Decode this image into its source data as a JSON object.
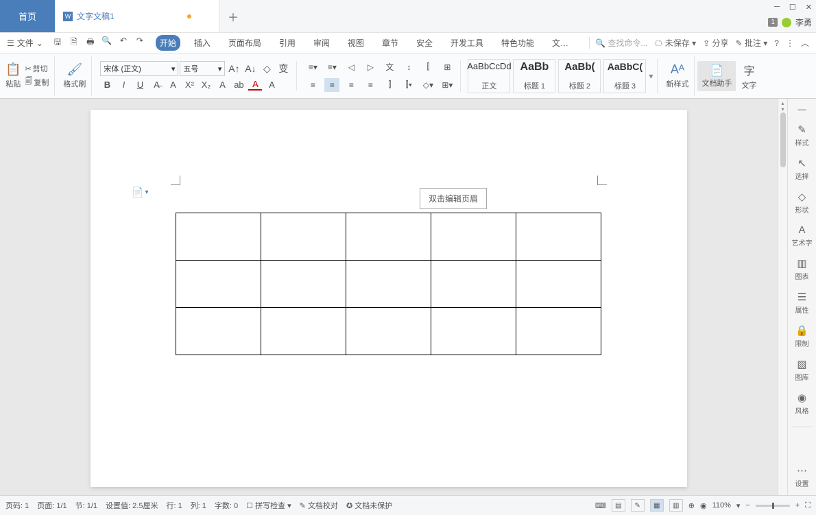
{
  "titlebar": {
    "home_tab": "首页",
    "doc_tab": "文字文稿1",
    "badge": "1",
    "username": "李勇"
  },
  "menubar": {
    "file": "文件",
    "tabs": [
      "开始",
      "插入",
      "页面布局",
      "引用",
      "审阅",
      "视图",
      "章节",
      "安全",
      "开发工具",
      "特色功能",
      "文…"
    ],
    "active_tab_index": 0,
    "search_placeholder": "查找命令...",
    "unsaved": "未保存",
    "share": "分享",
    "comments": "批注"
  },
  "ribbon": {
    "cut": "剪切",
    "copy": "复制",
    "paste": "粘贴",
    "format_painter": "格式刷",
    "font_name": "宋体 (正文)",
    "font_size": "五号",
    "styles": [
      {
        "sample": "AaBbCcDd",
        "name": "正文"
      },
      {
        "sample": "AaBb",
        "name": "标题 1"
      },
      {
        "sample": "AaBb(",
        "name": "标题 2"
      },
      {
        "sample": "AaBbC(",
        "name": "标题 3"
      }
    ],
    "new_style": "新样式",
    "doc_helper": "文档助手",
    "text_tool": "文字"
  },
  "document": {
    "header_tooltip": "双击编辑页眉",
    "table": {
      "rows": 3,
      "cols": 5
    }
  },
  "right_rail": [
    {
      "icon": "✎",
      "label": "样式"
    },
    {
      "icon": "↖",
      "label": "选择"
    },
    {
      "icon": "◇",
      "label": "形状"
    },
    {
      "icon": "A",
      "label": "艺术字"
    },
    {
      "icon": "▥",
      "label": "图表"
    },
    {
      "icon": "☰",
      "label": "属性"
    },
    {
      "icon": "🔒",
      "label": "限制"
    },
    {
      "icon": "▧",
      "label": "图库"
    },
    {
      "icon": "◉",
      "label": "风格"
    }
  ],
  "right_rail_settings": "设置",
  "status": {
    "page_num": "页码: 1",
    "page": "页面: 1/1",
    "section": "节: 1/1",
    "setting": "设置值: 2.5厘米",
    "line": "行: 1",
    "col": "列: 1",
    "words": "字数: 0",
    "spell": "拼写检查",
    "proof": "文档校对",
    "protect": "文档未保护",
    "zoom": "110%"
  }
}
